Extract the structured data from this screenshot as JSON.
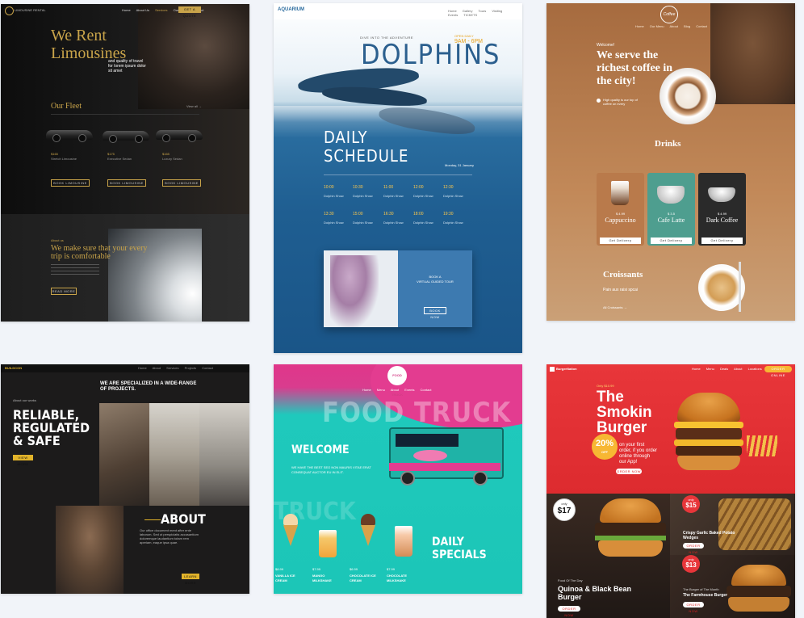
{
  "limo": {
    "logo": "LIMOUSINE RENTAL",
    "nav": [
      "Home",
      "About Us",
      "Services",
      "Our Fleet",
      "Contact"
    ],
    "nav_button": "GET A QUOTE",
    "title_line1": "We Rent",
    "title_line2": "Limousines",
    "tagline": "and quality of travel for lorem ipsum dolor sit amet",
    "fleet_heading": "Our Fleet",
    "fleet_link": "View all →",
    "cars": [
      {
        "price": "$165",
        "name": "Stretch Limousine",
        "button": "BOOK LIMOUSINE"
      },
      {
        "price": "$175",
        "name": "Executive Sedan",
        "button": "BOOK LIMOUSINE"
      },
      {
        "price": "$165",
        "name": "Luxury Sedan",
        "button": "BOOK LIMOUSINE"
      }
    ],
    "about_label": "About us",
    "about_line1": "We make sure that your every",
    "about_line2": "trip is comfortable",
    "about_button": "READ MORE"
  },
  "dolphins": {
    "logo": "AQUARIUM",
    "nav": [
      "Home",
      "Gallery",
      "Tours",
      "Visiting",
      "Events",
      "TICKETS"
    ],
    "eyebrow": "DIVE INTO THE ADVENTURE",
    "title": "DOLPHINS",
    "hours_label": "OPEN DAILY",
    "hours": "9AM - 6PM",
    "schedule_title_line1": "DAILY",
    "schedule_title_line2": "SCHEDULE",
    "date": "Monday, 31 January",
    "times_row1": [
      "10:00",
      "10:30",
      "11:00",
      "12:00",
      "12:30"
    ],
    "times_row2": [
      "13:30",
      "15:00",
      "16:30",
      "18:00",
      "19:30"
    ],
    "show_label": "Dolphin Show",
    "vr_line1": "BOOK A",
    "vr_line2": "VIRTUAL GUIDED TOUR",
    "vr_button": "BOOK NOW"
  },
  "coffee": {
    "logo": "Coffee",
    "nav": [
      "Home",
      "Our Menu",
      "About",
      "Blog",
      "Contact"
    ],
    "welcome": "Welcome!",
    "title_line1": "We serve the",
    "title_line2": "richest coffee in",
    "title_line3": "the city!",
    "note": "High quality is our top of coffee on every",
    "drinks_heading": "Drinks",
    "drinks": [
      {
        "price": "$ 4.99",
        "name": "Cappuccino",
        "button": "Get Delivery",
        "color": "#b97a4b"
      },
      {
        "price": "$ 3.5",
        "name": "Cafe Latte",
        "button": "Get Delivery",
        "color": "#4e9e8f"
      },
      {
        "price": "$ 4.99",
        "name": "Dark Coffee",
        "button": "Get Delivery",
        "color": "#2a2a2a"
      }
    ],
    "croissants_heading": "Croissants",
    "croissants_sub": "Pain aux raisi spcai",
    "croissants_link": "All Croissants  →"
  },
  "reliable": {
    "logo": "BUILDCON",
    "nav": [
      "Home",
      "About",
      "Services",
      "Projects",
      "Contact"
    ],
    "specialized_line1": "WE ARE SPECIALIZED IN A WIDE-RANGE",
    "specialized_line2": "OF PROJECTS.",
    "eyebrow": "About our works",
    "title_line1": "RELIABLE,",
    "title_line2": "REGULATED",
    "title_line3": "& SAFE",
    "cta": "VIEW MORE",
    "about_heading": "ABOUT",
    "about_text": "Our office document ment after ente laborum. Sed ut perspiciatis accusantium doloremque laudantium totam rem aperiam, eaque ipsa quae.",
    "about_button": "LEARN MORE"
  },
  "foodtruck": {
    "logo": "FOOD TRUCK",
    "nav": [
      "Home",
      "Menu",
      "About",
      "Events",
      "Contact"
    ],
    "title": "FOOD TRUCK",
    "welcome": "WELCOME",
    "welcome_text_line1": "WE HAVE THE BEST SEO NON MAURIS VITAE ERAT",
    "welcome_text_line2": "CONSEQUAT AUCTOR EU IN ELIT.",
    "bg_word": "TRUCK",
    "specials_line1": "DAILY",
    "specials_line2": "SPECIALS",
    "items": [
      {
        "price": "$8.99",
        "name_line1": "VANILLA ICE",
        "name_line2": "CREAM"
      },
      {
        "price": "$7.99",
        "name_line1": "MANGO",
        "name_line2": "MILKSHAKE"
      },
      {
        "price": "$6.99",
        "name_line1": "CHOCOLATE ICE",
        "name_line2": "CREAM"
      },
      {
        "price": "$7.99",
        "name_line1": "CHOCOLATE",
        "name_line2": "MILKSHAKE"
      }
    ]
  },
  "burger": {
    "logo": "BurgerNation",
    "nav": [
      "Home",
      "Menu",
      "Deals",
      "About",
      "Locations",
      "Contact"
    ],
    "nav_button": "ORDER ONLINE",
    "price_tag": "Only $10.99",
    "title_line1": "The",
    "title_line2": "Smokin",
    "title_line3": "Burger",
    "discount": "20%",
    "discount_off": "OFF",
    "promo_line1": "on your first",
    "promo_line2": "order, if you order",
    "promo_line3": "online through",
    "promo_line4": "our App!",
    "order_button": "ORDER NOW",
    "badge_only": "only",
    "badge1_price": "$17",
    "food_day_label": "Food Of The Day",
    "food_day_name_line1": "Quinoa & Black Bean",
    "food_day_name_line2": "Burger",
    "badge2_price": "$15",
    "deal2_line1": "Crispy Garlic Baked Potato",
    "deal2_line2": "Wedges",
    "badge3_price": "$13",
    "deal3_label": "The Burger of The Month",
    "deal3_name": "The Farmhouse Burger"
  }
}
